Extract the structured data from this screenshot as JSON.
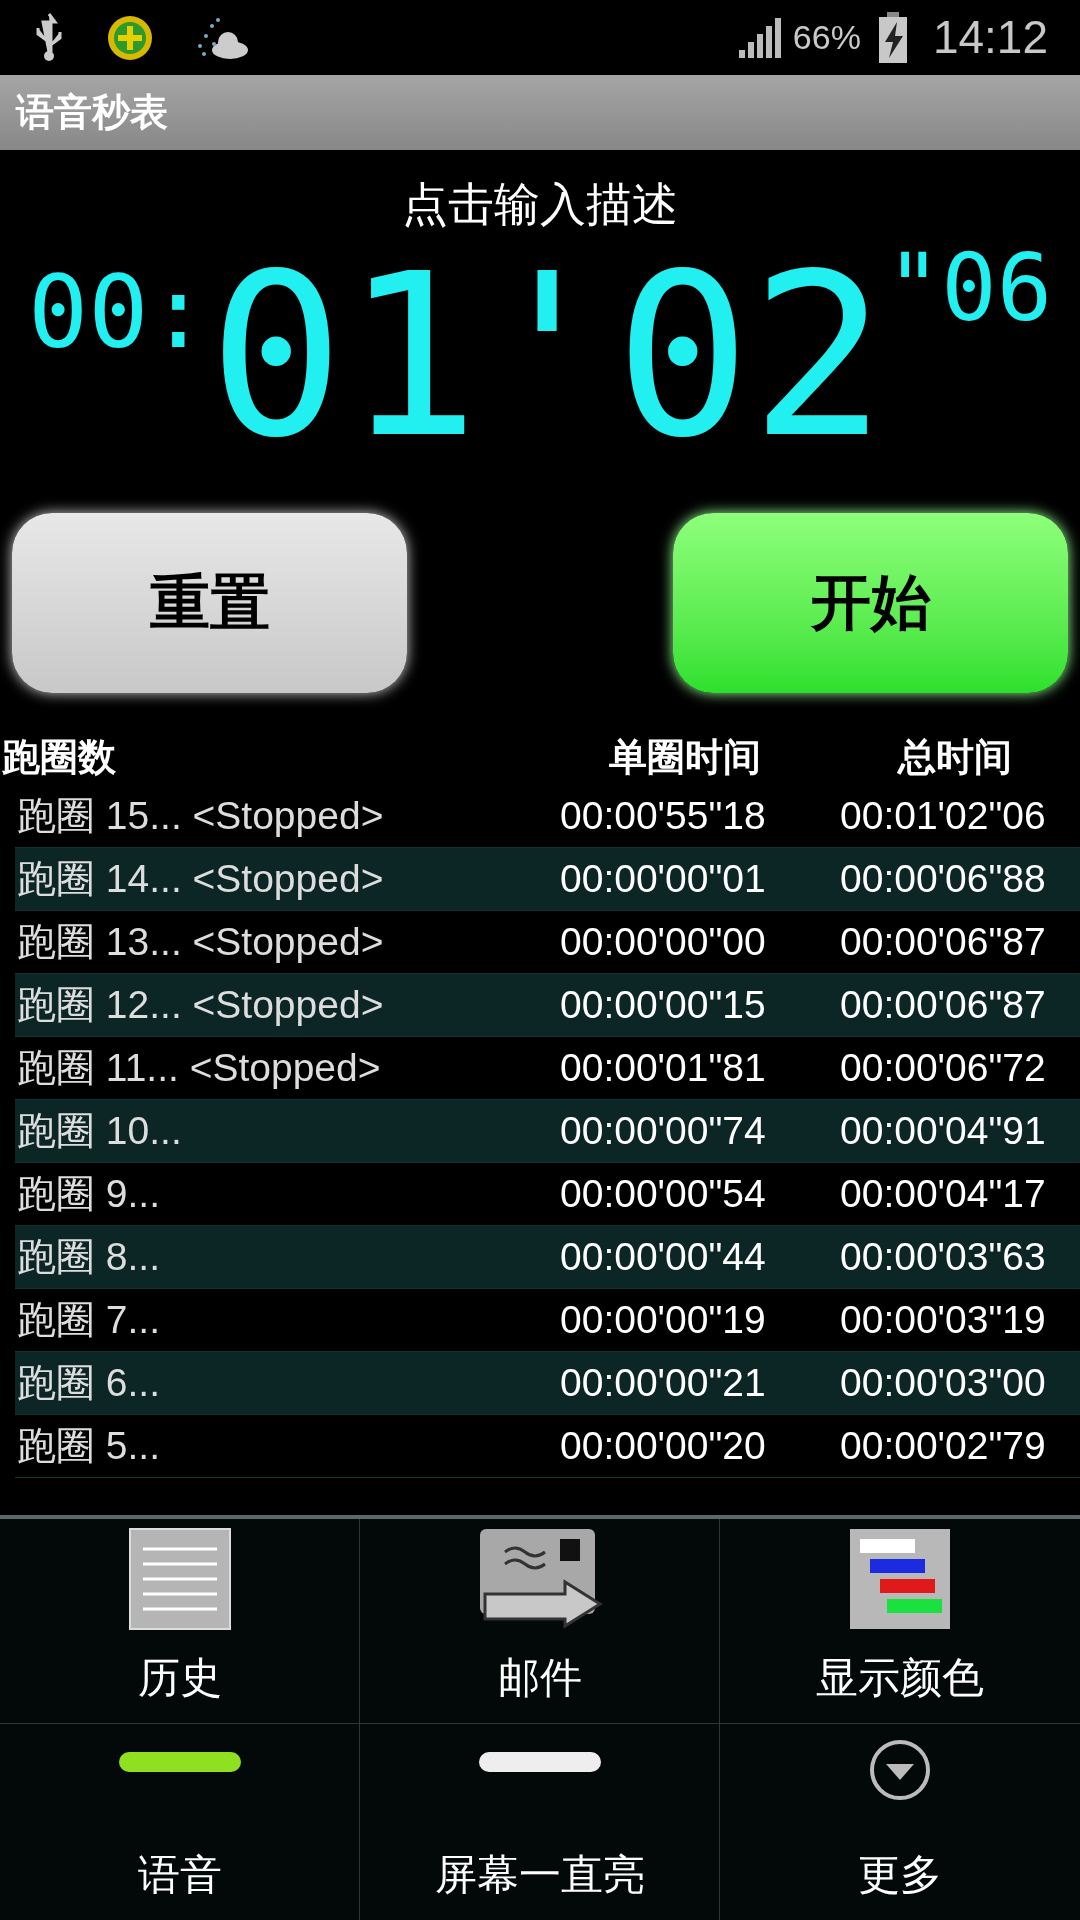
{
  "status_bar": {
    "signal_percent": "66%",
    "time": "14:12"
  },
  "title": "语音秒表",
  "description": "点击输入描述",
  "display": {
    "hours": "00:",
    "main": "01'02",
    "hundredths": "\"06"
  },
  "buttons": [
    {
      "label": "重置",
      "kind": "reset"
    },
    {
      "label": "开始",
      "kind": "start"
    }
  ],
  "table": {
    "columns": [
      "跑圈数",
      "单圈时间",
      "总时间"
    ],
    "rows": [
      {
        "lap": "跑圈 15... <Stopped>",
        "split": "00:00'55\"18",
        "total": "00:01'02\"06"
      },
      {
        "lap": "跑圈 14... <Stopped>",
        "split": "00:00'00\"01",
        "total": "00:00'06\"88"
      },
      {
        "lap": "跑圈 13... <Stopped>",
        "split": "00:00'00\"00",
        "total": "00:00'06\"87"
      },
      {
        "lap": "跑圈 12... <Stopped>",
        "split": "00:00'00\"15",
        "total": "00:00'06\"87"
      },
      {
        "lap": "跑圈 11... <Stopped>",
        "split": "00:00'01\"81",
        "total": "00:00'06\"72"
      },
      {
        "lap": "跑圈 10...",
        "split": "00:00'00\"74",
        "total": "00:00'04\"91"
      },
      {
        "lap": "跑圈 9...",
        "split": "00:00'00\"54",
        "total": "00:00'04\"17"
      },
      {
        "lap": "跑圈 8...",
        "split": "00:00'00\"44",
        "total": "00:00'03\"63"
      },
      {
        "lap": "跑圈 7...",
        "split": "00:00'00\"19",
        "total": "00:00'03\"19"
      },
      {
        "lap": "跑圈 6...",
        "split": "00:00'00\"21",
        "total": "00:00'03\"00"
      },
      {
        "lap": "跑圈 5...",
        "split": "00:00'00\"20",
        "total": "00:00'02\"79"
      }
    ]
  },
  "menu": {
    "items": [
      {
        "label": "历史",
        "kind": "history"
      },
      {
        "label": "邮件",
        "kind": "mail"
      },
      {
        "label": "显示颜色",
        "kind": "colors"
      }
    ],
    "toggles": [
      {
        "label": "语音",
        "on": true
      },
      {
        "label": "屏幕一直亮",
        "on": false
      }
    ],
    "more": "更多"
  }
}
